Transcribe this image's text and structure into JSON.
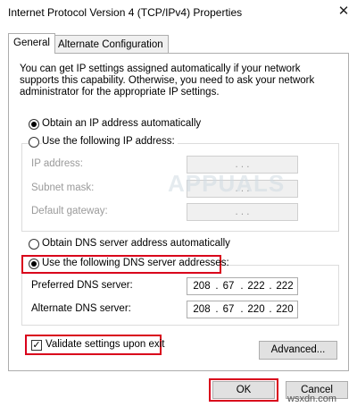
{
  "window": {
    "title": "Internet Protocol Version 4 (TCP/IPv4) Properties",
    "close_glyph": "✕"
  },
  "tabs": [
    {
      "label": "General"
    },
    {
      "label": "Alternate Configuration"
    }
  ],
  "description": "You can get IP settings assigned automatically if your network supports this capability. Otherwise, you need to ask your network administrator for the appropriate IP settings.",
  "ip": {
    "auto_label": "Obtain an IP address automatically",
    "manual_label": "Use the following IP address:",
    "fields": [
      {
        "label": "IP address:",
        "value": ".     .     ."
      },
      {
        "label": "Subnet mask:",
        "value": ".     .     ."
      },
      {
        "label": "Default gateway:",
        "value": ".     .     ."
      }
    ]
  },
  "dns": {
    "auto_label": "Obtain DNS server address automatically",
    "manual_label": "Use the following DNS server addresses:",
    "preferred": {
      "label": "Preferred DNS server:",
      "octets": [
        "208",
        "67",
        "222",
        "222"
      ]
    },
    "alternate": {
      "label": "Alternate DNS server:",
      "octets": [
        "208",
        "67",
        "220",
        "220"
      ]
    }
  },
  "validate": {
    "label": "Validate settings upon exit",
    "checked": true,
    "check_glyph": "✓"
  },
  "buttons": {
    "advanced": "Advanced...",
    "ok": "OK",
    "cancel": "Cancel"
  },
  "watermark": "APPUALS",
  "footer_mark": "wsxdn.com",
  "colors": {
    "highlight": "#d9001b",
    "button_face": "#e1e1e1",
    "disabled_field": "#f0f0f0"
  }
}
